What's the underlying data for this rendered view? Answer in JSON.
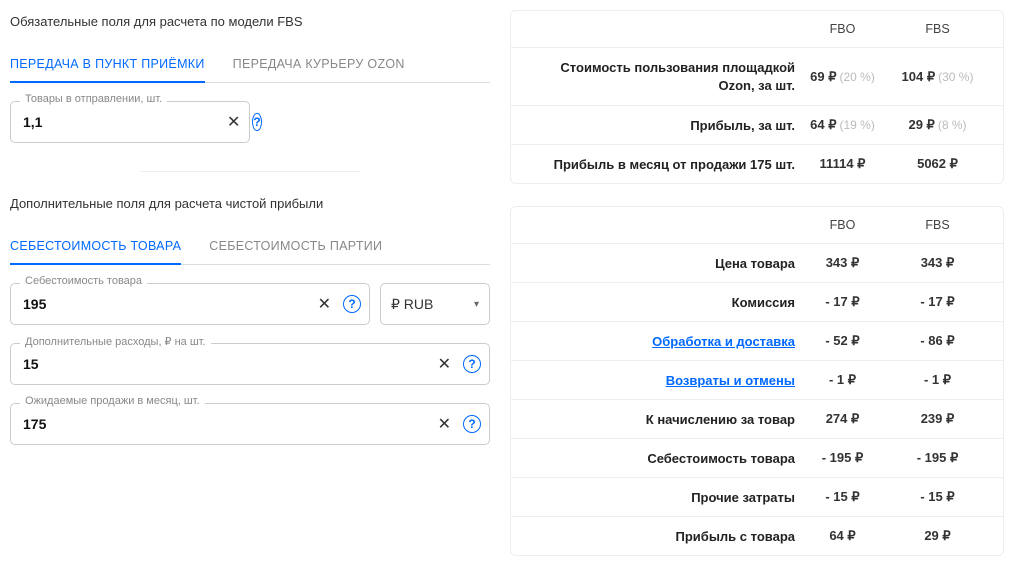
{
  "left": {
    "required_label": "Обязательные поля для расчета по модели FBS",
    "tabs1": {
      "active": "ПЕРЕДАЧА В ПУНКТ ПРИЁМКИ",
      "inactive": "ПЕРЕДАЧА КУРЬЕРУ OZON"
    },
    "items_label": "Товары в отправлении, шт.",
    "items_value": "1,1",
    "extra_label": "Дополнительные поля для расчета чистой прибыли",
    "tabs2": {
      "active": "СЕБЕСТОИМОСТЬ ТОВАРА",
      "inactive": "СЕБЕСТОИМОСТЬ ПАРТИИ"
    },
    "cost_label": "Себестоимость товара",
    "cost_value": "195",
    "currency": "₽ RUB",
    "addcost_label": "Дополнительные расходы, ₽ на шт.",
    "addcost_value": "15",
    "sales_label": "Ожидаемые продажи в месяц, шт.",
    "sales_value": "175",
    "clear": "✕",
    "help": "?"
  },
  "summary": {
    "h_fbo": "FBO",
    "h_fbs": "FBS",
    "r1_label": "Стоимость пользования площадкой Ozon, за шт.",
    "r1_fbo": "69 ₽",
    "r1_fbo_pct": "(20 %)",
    "r1_fbs": "104 ₽",
    "r1_fbs_pct": "(30 %)",
    "r2_label": "Прибыль, за шт.",
    "r2_fbo": "64 ₽",
    "r2_fbo_pct": "(19 %)",
    "r2_fbs": "29 ₽",
    "r2_fbs_pct": "(8 %)",
    "r3_label": "Прибыль в месяц от продажи 175 шт.",
    "r3_fbo": "11114 ₽",
    "r3_fbs": "5062 ₽"
  },
  "detail": {
    "h_fbo": "FBO",
    "h_fbs": "FBS",
    "r1_label": "Цена товара",
    "r1_fbo": "343 ₽",
    "r1_fbs": "343 ₽",
    "r2_label": "Комиссия",
    "r2_fbo": "- 17 ₽",
    "r2_fbs": "- 17 ₽",
    "r3_label": "Обработка и доставка",
    "r3_fbo": "- 52 ₽",
    "r3_fbs": "- 86 ₽",
    "r4_label": "Возвраты и отмены",
    "r4_fbo": "- 1 ₽",
    "r4_fbs": "- 1 ₽",
    "r5_label": "К начислению за товар",
    "r5_fbo": "274 ₽",
    "r5_fbs": "239 ₽",
    "r6_label": "Себестоимость товара",
    "r6_fbo": "- 195 ₽",
    "r6_fbs": "- 195 ₽",
    "r7_label": "Прочие затраты",
    "r7_fbo": "- 15 ₽",
    "r7_fbs": "- 15 ₽",
    "r8_label": "Прибыль с товара",
    "r8_fbo": "64 ₽",
    "r8_fbs": "29 ₽"
  }
}
